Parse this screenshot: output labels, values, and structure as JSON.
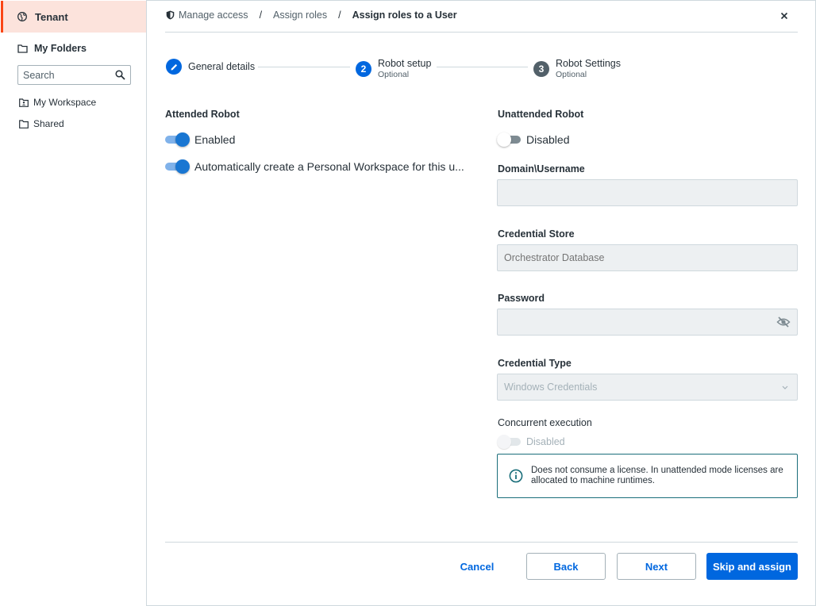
{
  "sidebar": {
    "tenant_label": "Tenant",
    "my_folders_label": "My Folders",
    "search_placeholder": "Search",
    "items": [
      {
        "label": "My Workspace"
      },
      {
        "label": "Shared"
      }
    ]
  },
  "header": {
    "breadcrumb": [
      "Manage access",
      "Assign roles",
      "Assign roles to a User"
    ],
    "separator": "/"
  },
  "stepper": {
    "steps": [
      {
        "label": "General details",
        "sub": "",
        "state": "done"
      },
      {
        "number": "2",
        "label": "Robot setup",
        "sub": "Optional",
        "state": "active"
      },
      {
        "number": "3",
        "label": "Robot Settings",
        "sub": "Optional",
        "state": "pending"
      }
    ]
  },
  "attended": {
    "title": "Attended Robot",
    "enabled_label": "Enabled",
    "enabled": true,
    "auto_workspace_label": "Automatically create a Personal Workspace for this u...",
    "auto_workspace": true
  },
  "unattended": {
    "title": "Unattended Robot",
    "toggle_label": "Disabled",
    "enabled": false,
    "domain_label": "Domain\\Username",
    "domain_value": "",
    "credential_store_label": "Credential Store",
    "credential_store_placeholder": "Orchestrator Database",
    "password_label": "Password",
    "password_value": "",
    "credential_type_label": "Credential Type",
    "credential_type_value": "Windows Credentials",
    "concurrent_label": "Concurrent execution",
    "concurrent_toggle_label": "Disabled",
    "info_text": "Does not consume a license. In unattended mode licenses are allocated to machine runtimes."
  },
  "footer": {
    "cancel": "Cancel",
    "back": "Back",
    "next": "Next",
    "skip": "Skip and assign"
  },
  "colors": {
    "accent": "#0067df",
    "tenant_bg": "#fce3dc",
    "tenant_border": "#fa4616",
    "step_done": "#0067df",
    "step_pending": "#526069"
  }
}
